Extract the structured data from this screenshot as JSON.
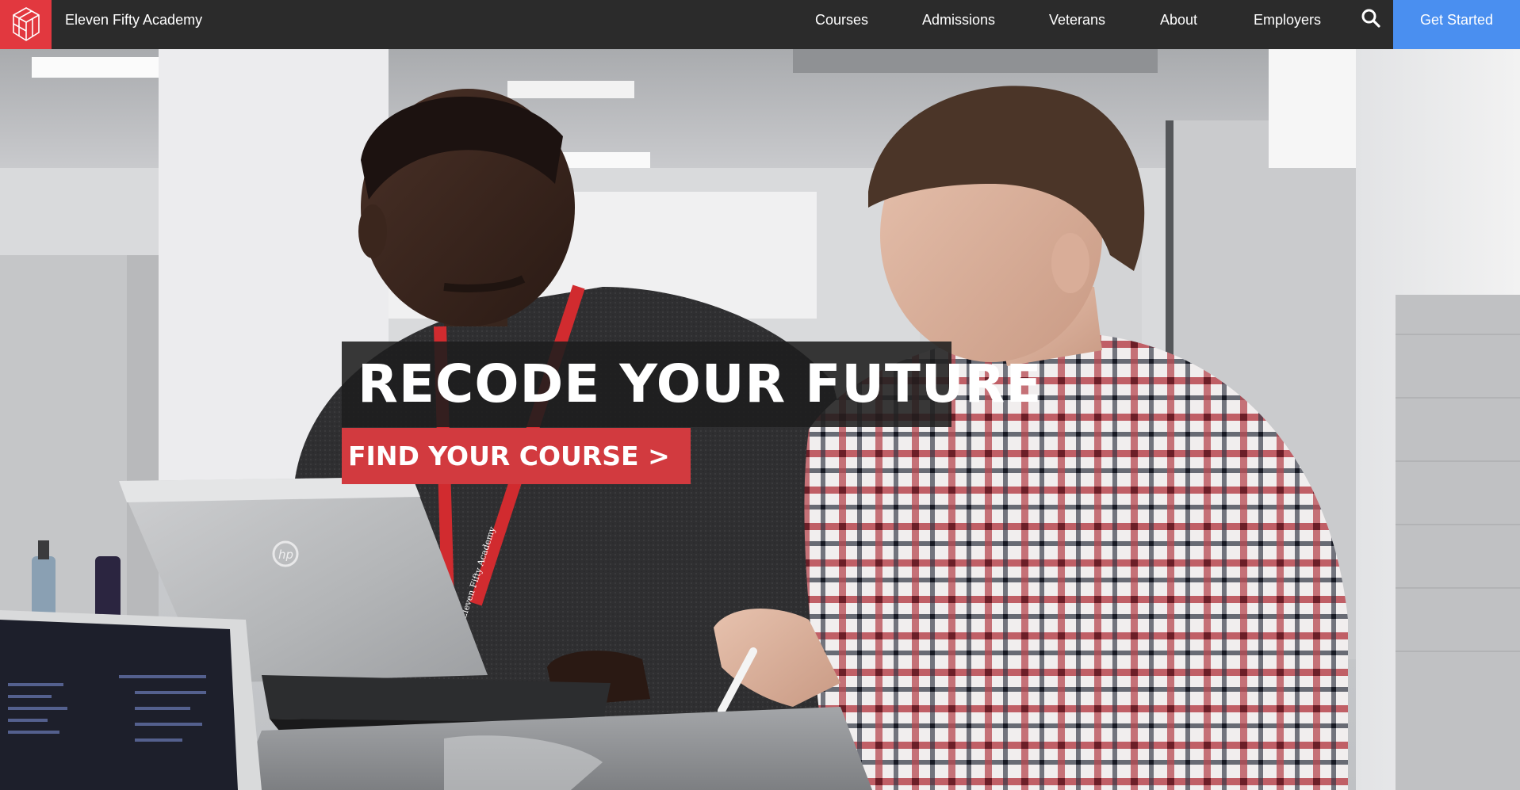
{
  "brand": {
    "name": "Eleven Fifty Academy",
    "logo_color": "#e2383f"
  },
  "nav": {
    "items": [
      {
        "label": "Courses"
      },
      {
        "label": "Admissions"
      },
      {
        "label": "Veterans"
      },
      {
        "label": "About"
      },
      {
        "label": "Employers"
      }
    ],
    "search_icon": "search-icon",
    "cta_label": "Get Started",
    "cta_color": "#4a8ff0",
    "bar_color": "#2b2b2b"
  },
  "hero": {
    "headline": "RECODE YOUR FUTURE",
    "button_label": "FIND YOUR COURSE >",
    "button_color": "#d23a3f",
    "lanyard_text": "Eleven Fifty Academy",
    "laptop_logo": "hp"
  }
}
